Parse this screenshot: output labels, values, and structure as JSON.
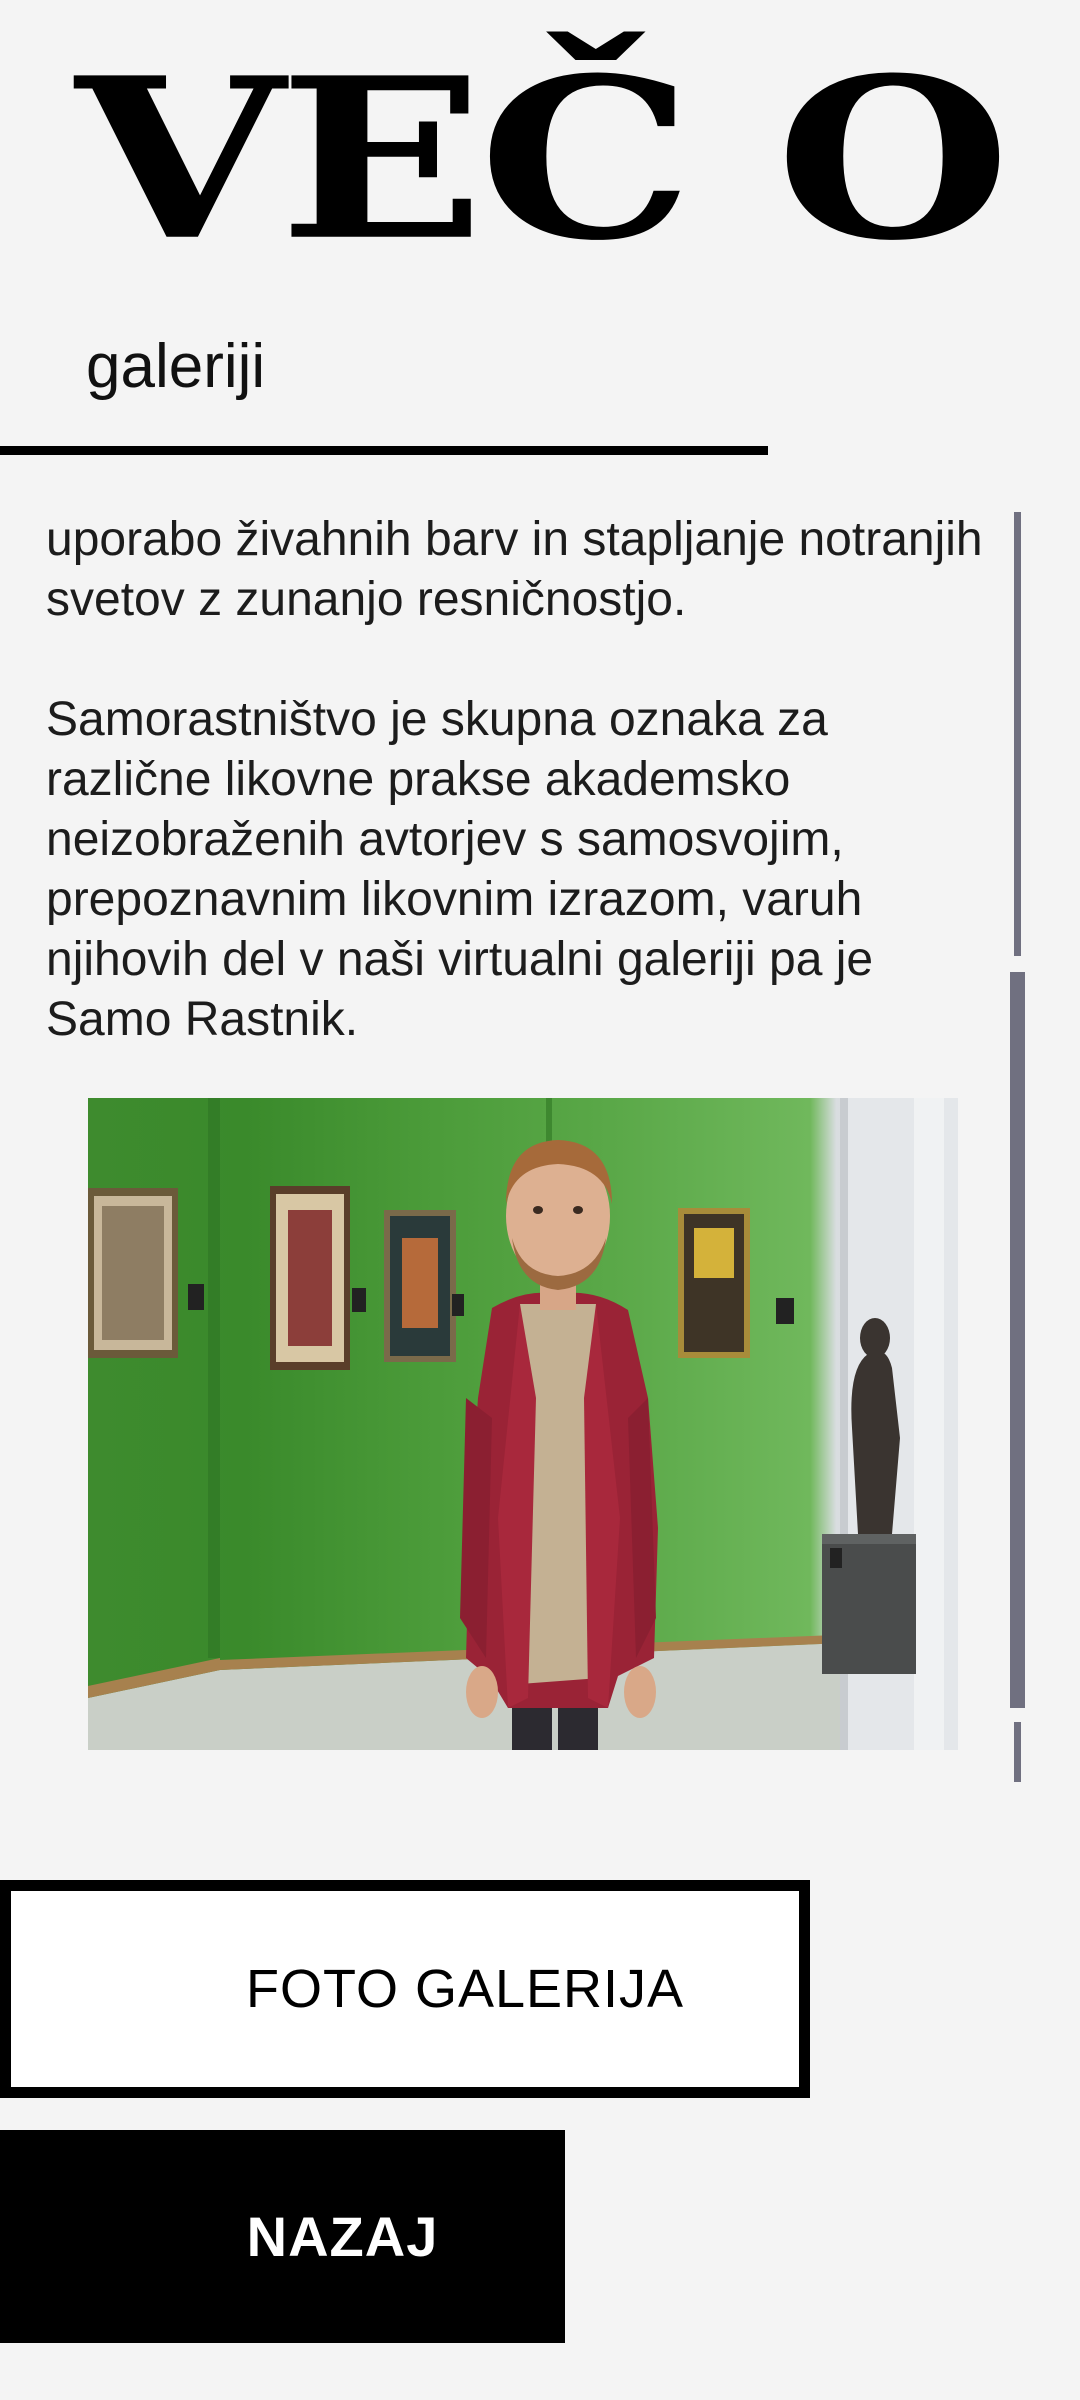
{
  "header": {
    "title": "VEČ O",
    "subtitle": "galeriji"
  },
  "content": {
    "paragraphs": [
      "uporabo živahnih barv in stapljanje notranjih svetov z zunanjo resničnostjo.",
      "Samorastništvo je skupna oznaka za različne likovne prakse akademsko neizobraženih avtorjev s samosvojim, prepoznavnim likovnim izrazom, varuh njihovih del v naši virtualni galeriji pa je Samo Rastnik."
    ]
  },
  "buttons": {
    "gallery_label": "FOTO GALERIJA",
    "back_label": "NAZAJ"
  },
  "colors": {
    "background": "#f4f4f4",
    "primary": "#000000",
    "scrollbar": "#707080"
  }
}
